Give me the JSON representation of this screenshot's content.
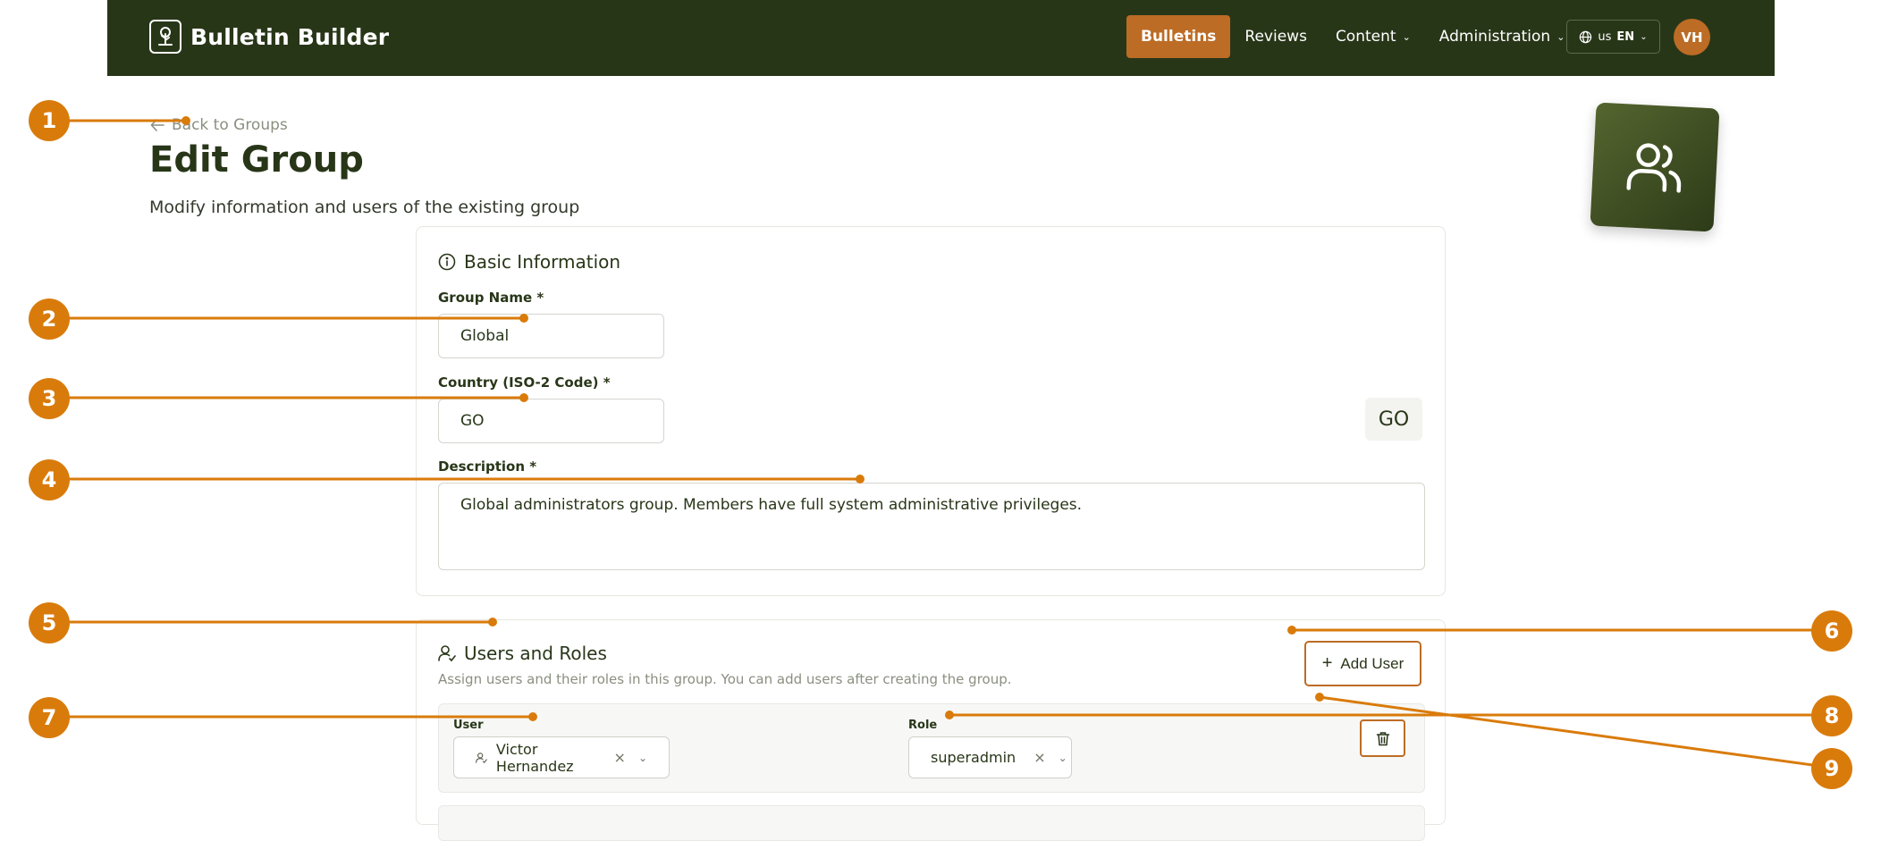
{
  "app": {
    "name": "Bulletin Builder"
  },
  "nav": {
    "items": [
      {
        "label": "Bulletins",
        "dropdown": false,
        "active": true
      },
      {
        "label": "Reviews",
        "dropdown": false,
        "active": false
      },
      {
        "label": "Content",
        "dropdown": true,
        "active": false
      },
      {
        "label": "Administration",
        "dropdown": true,
        "active": false
      }
    ],
    "language": {
      "flag": "us",
      "code": "EN"
    },
    "user_initials": "VH"
  },
  "page": {
    "back_link": "Back to Groups",
    "title": "Edit Group",
    "subtitle": "Modify information and users of the existing group"
  },
  "basic_info": {
    "title": "Basic Information",
    "group_name_label": "Group Name *",
    "group_name_value": "Global",
    "country_label": "Country (ISO-2 Code) *",
    "country_value": "GO",
    "country_tag": "GO",
    "description_label": "Description *",
    "description_value": "Global administrators group. Members have full system administrative privileges."
  },
  "users_roles": {
    "title": "Users and Roles",
    "hint": "Assign users and their roles in this group. You can add users after creating the group.",
    "add_user_label": "Add User",
    "rows": [
      {
        "user_label": "User",
        "user": "Victor Hernandez",
        "role_label": "Role",
        "role": "superadmin"
      }
    ]
  },
  "callouts": [
    "1",
    "2",
    "3",
    "4",
    "5",
    "6",
    "7",
    "8",
    "9"
  ],
  "colors": {
    "navbar": "#283618",
    "accent": "#bc6c25",
    "callout": "#d97b0b"
  },
  "icons": [
    "tree-logo-icon",
    "chevron-down-icon",
    "globe-icon",
    "arrow-left-icon",
    "users-icon",
    "info-icon",
    "user-check-icon",
    "plus-icon",
    "close-icon",
    "trash-icon"
  ]
}
